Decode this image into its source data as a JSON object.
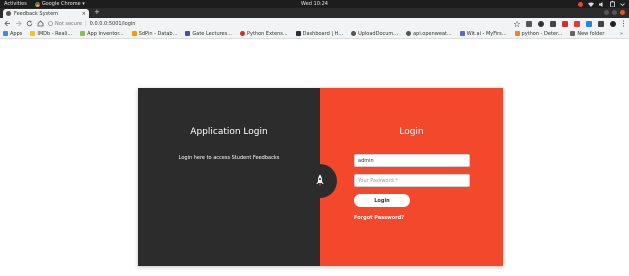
{
  "system_bar": {
    "activities": "Activities",
    "app_name": "Google Chrome ▾",
    "clock": "Wed 10:24"
  },
  "browser": {
    "tab_title": "Feedback System",
    "tab_close": "×",
    "new_tab": "+",
    "secure_label": "Not secure",
    "url": "0.0.0.0:5001/login",
    "bookmarks": [
      {
        "label": "Apps",
        "icon": "apps-grid-icon",
        "color": "#4285f4"
      },
      {
        "label": "IMDb - Reali...",
        "icon": "bookmark-icon",
        "color": "#f5c518"
      },
      {
        "label": "App Inventor...",
        "icon": "bookmark-icon",
        "color": "#8bc34a"
      },
      {
        "label": "SdPin - Datab...",
        "icon": "bookmark-icon",
        "color": "#ff9800"
      },
      {
        "label": "Gate Lectures...",
        "icon": "bookmark-icon",
        "color": "#3f51b5"
      },
      {
        "label": "Python Extens...",
        "icon": "bookmark-icon",
        "color": "#d32f2f"
      },
      {
        "label": "Dashboard | H...",
        "icon": "bookmark-icon",
        "color": "#263238"
      },
      {
        "label": "UploadDocum...",
        "icon": "globe-icon",
        "color": "#555555"
      },
      {
        "label": "api.openweat...",
        "icon": "globe-icon",
        "color": "#555555"
      },
      {
        "label": "Wit.ai - MyFirs...",
        "icon": "bookmark-icon",
        "color": "#5c6bc0"
      },
      {
        "label": "python - Deter...",
        "icon": "bookmark-icon",
        "color": "#f48024"
      },
      {
        "label": "New folder",
        "icon": "folder-icon",
        "color": "#666666"
      }
    ],
    "more": "»"
  },
  "login_page": {
    "left_title": "Application Login",
    "left_subtitle": "Login here to access Student Feedbacks",
    "right_title": "Login",
    "username_value": "admin",
    "password_placeholder": "Your Password *",
    "login_button": "Login",
    "forgot_link": "Forgot Password?",
    "colors": {
      "left_bg": "#2c2c2c",
      "right_bg": "#f4482c"
    }
  }
}
